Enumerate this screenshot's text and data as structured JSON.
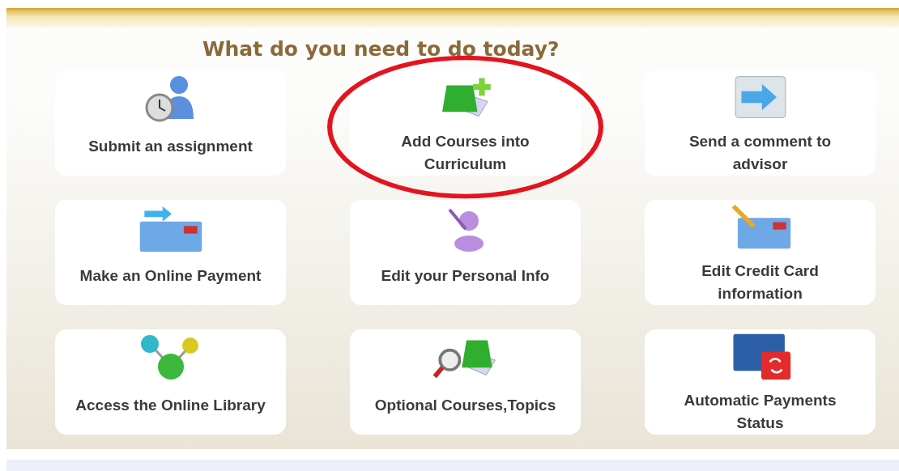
{
  "heading": "What do you need to do today?",
  "tasks": [
    {
      "label": "Submit an assignment",
      "highlighted": false
    },
    {
      "label": "Add Courses into Curriculum",
      "highlighted": true
    },
    {
      "label": "Send a comment to advisor",
      "highlighted": false
    },
    {
      "label": "Make an Online Payment",
      "highlighted": false
    },
    {
      "label": "Edit your Personal Info",
      "highlighted": false
    },
    {
      "label": "Edit Credit Card information",
      "highlighted": false
    },
    {
      "label": "Access the Online Library",
      "highlighted": false
    },
    {
      "label": "Optional Courses,Topics",
      "highlighted": false
    },
    {
      "label": "Automatic Payments Status",
      "highlighted": false
    }
  ]
}
